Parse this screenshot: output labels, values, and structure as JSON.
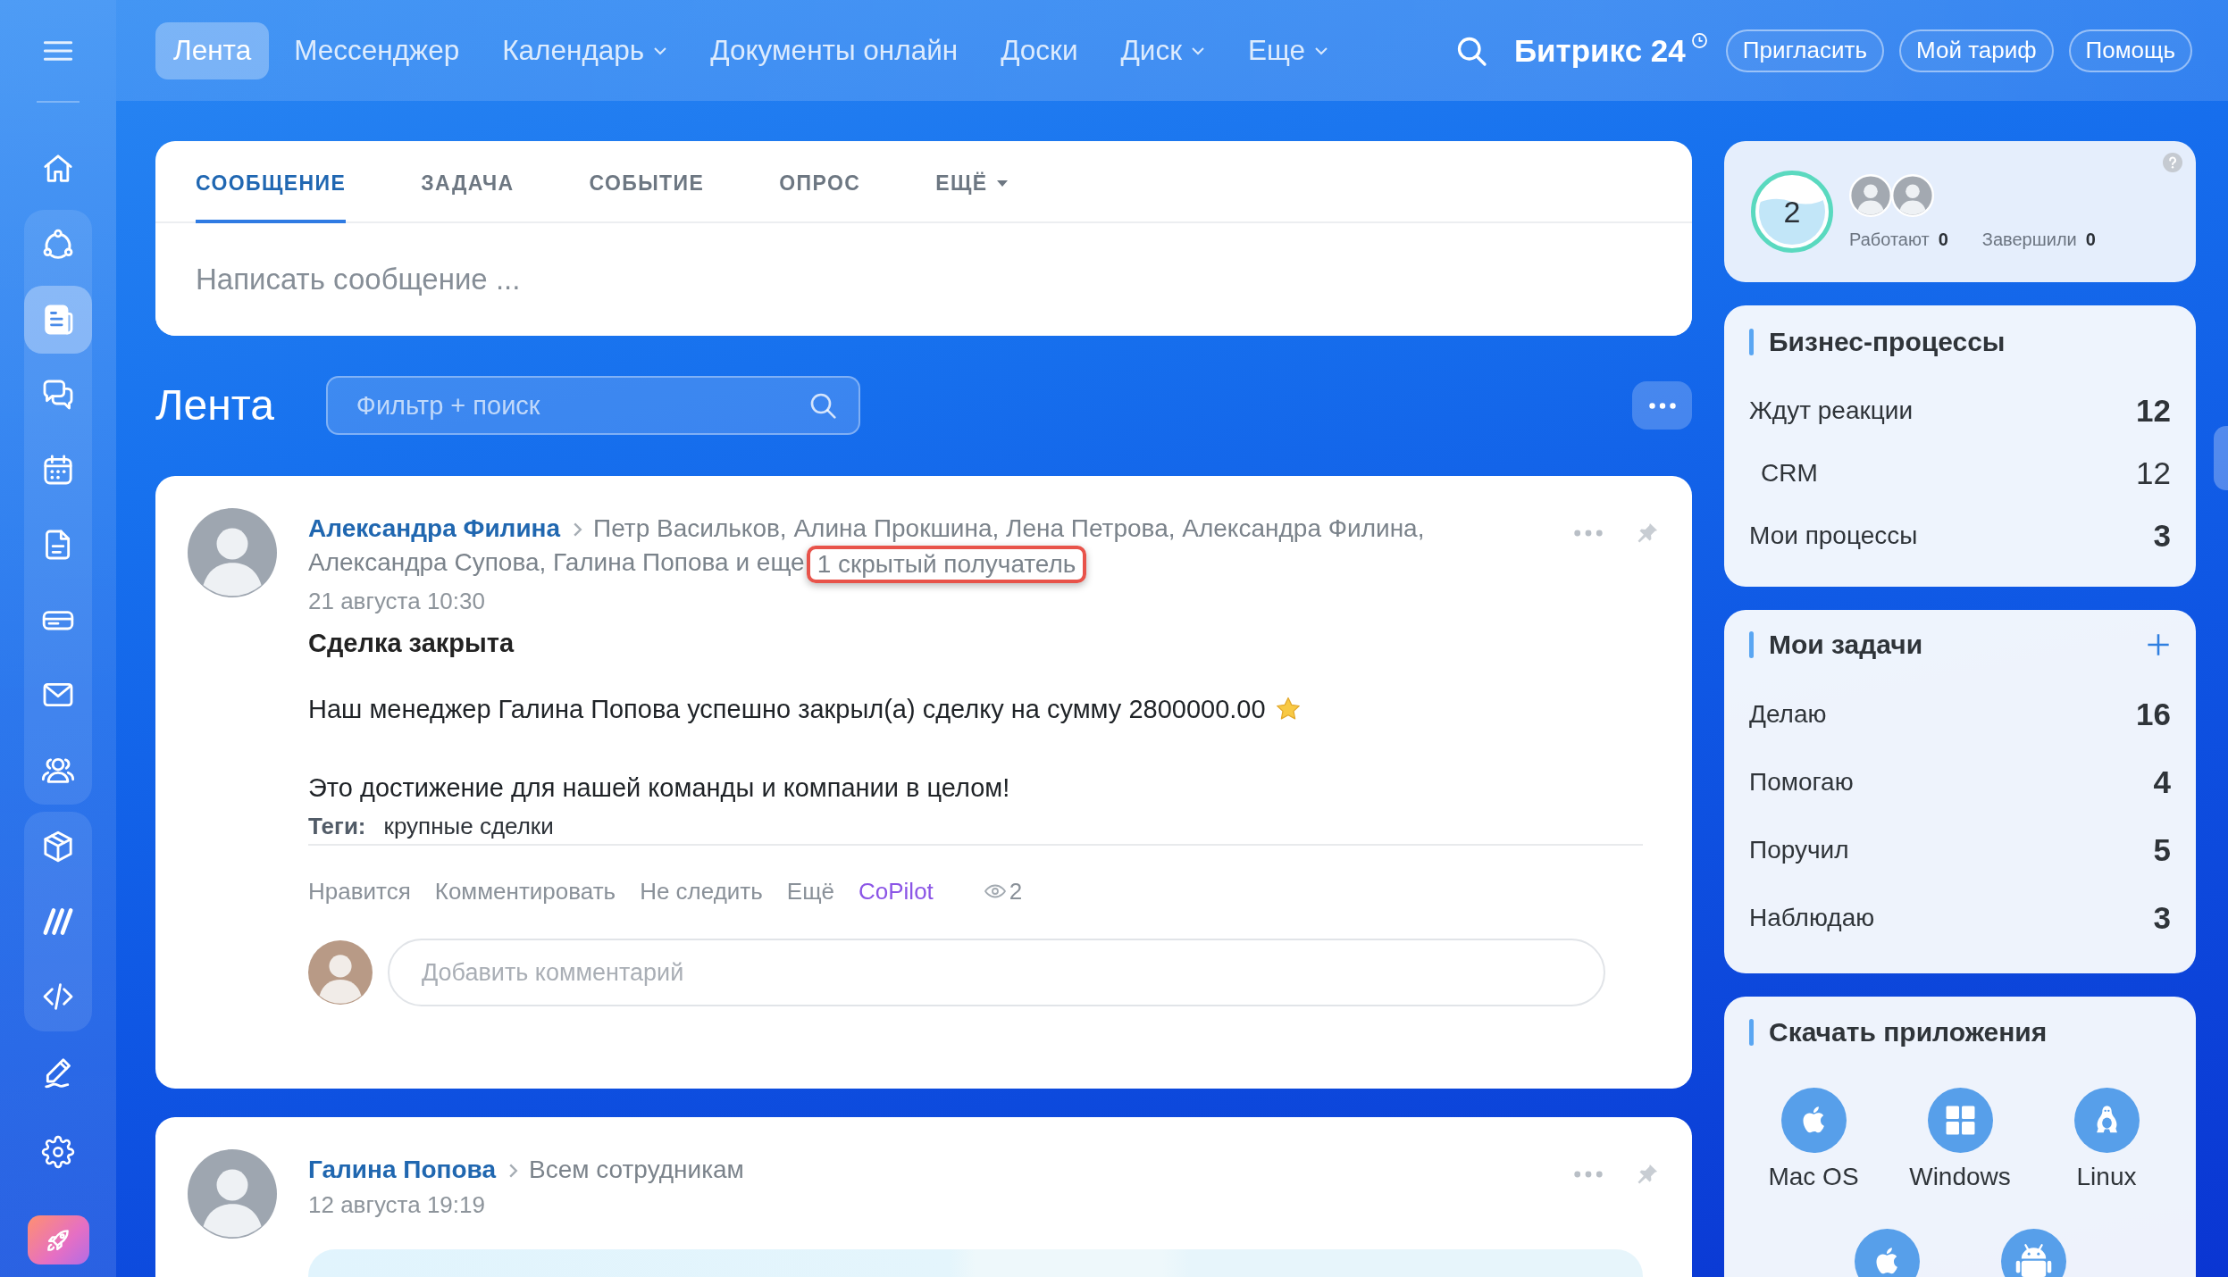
{
  "sidebar": {
    "sections": [
      {
        "boxed": false,
        "items": [
          {
            "kind": "home",
            "selected": false
          }
        ]
      },
      {
        "boxed": true,
        "items": [
          {
            "kind": "processes",
            "selected": false
          },
          {
            "kind": "feed",
            "selected": true
          },
          {
            "kind": "messenger",
            "selected": false
          },
          {
            "kind": "calendar",
            "selected": false
          },
          {
            "kind": "documents",
            "selected": false
          },
          {
            "kind": "drive",
            "selected": false
          },
          {
            "kind": "mail",
            "selected": false
          },
          {
            "kind": "team",
            "selected": false
          }
        ]
      },
      {
        "boxed": true,
        "items": [
          {
            "kind": "market",
            "selected": false
          },
          {
            "kind": "sign",
            "selected": false
          },
          {
            "kind": "developer",
            "selected": false
          }
        ]
      },
      {
        "boxed": false,
        "items": [
          {
            "kind": "edit",
            "selected": false
          },
          {
            "kind": "settings",
            "selected": false
          },
          {
            "kind": "launch",
            "selected": false
          }
        ]
      }
    ]
  },
  "nav": [
    {
      "label": "Лента",
      "selected": true,
      "dropdown": false
    },
    {
      "label": "Мессенджер",
      "selected": false,
      "dropdown": false
    },
    {
      "label": "Календарь",
      "selected": false,
      "dropdown": true
    },
    {
      "label": "Документы онлайн",
      "selected": false,
      "dropdown": false
    },
    {
      "label": "Доски",
      "selected": false,
      "dropdown": false
    },
    {
      "label": "Диск",
      "selected": false,
      "dropdown": true
    },
    {
      "label": "Еще",
      "selected": false,
      "dropdown": true
    }
  ],
  "header": {
    "brand": "Битрикс 24",
    "buttons": [
      "Пригласить",
      "Мой тариф",
      "Помощь"
    ]
  },
  "composer": {
    "tabs": [
      {
        "label": "СООБЩЕНИЕ",
        "selected": true,
        "dropdown": false
      },
      {
        "label": "ЗАДАЧА",
        "selected": false,
        "dropdown": false
      },
      {
        "label": "СОБЫТИЕ",
        "selected": false,
        "dropdown": false
      },
      {
        "label": "ОПРОС",
        "selected": false,
        "dropdown": false
      },
      {
        "label": "ЕЩЁ",
        "selected": false,
        "dropdown": true
      }
    ],
    "placeholder": "Написать сообщение ..."
  },
  "feed": {
    "title": "Лента",
    "filter": {
      "placeholder": "Фильтр + поиск"
    },
    "posts": [
      {
        "author": "Александра Филина",
        "recipients": "Петр Васильков, Алина Прокшина, Лена Петрова, Александра Филина, Александра Супова, Галина Попова и еще",
        "hidden_recipients": {
          "text": "1 скрытый получатель",
          "highlighted": true
        },
        "date": "21 августа 10:30",
        "title": "Сделка закрыта",
        "paragraphs": [
          {
            "text": "Наш менеджер Галина Попова успешно закрыл(а) сделку на сумму 2800000.00",
            "kind": "starred"
          },
          {
            "text": "Это достижение для нашей команды и компании в целом!",
            "kind": "plain"
          }
        ],
        "tags": {
          "label": "Теги:",
          "items": [
            "крупные сделки"
          ]
        },
        "actions": [
          {
            "label": "Нравится",
            "kind": "plain"
          },
          {
            "label": "Комментировать",
            "kind": "plain"
          },
          {
            "label": "Не следить",
            "kind": "plain"
          },
          {
            "label": "Ещё",
            "kind": "plain"
          },
          {
            "label": "CoPilot",
            "kind": "ai"
          }
        ],
        "views": "2",
        "comment_placeholder": "Добавить комментарий"
      },
      {
        "author": "Галина Попова",
        "recipients": "Всем сотрудникам",
        "date": "12 августа 19:19",
        "has_image": true
      }
    ]
  },
  "worktime": {
    "count": "2",
    "avatars": [
      {
        "kind": "photo"
      },
      {
        "kind": "photo"
      }
    ],
    "stats": [
      {
        "label": "Работают",
        "value": "0"
      },
      {
        "label": "Завершили",
        "value": "0"
      }
    ]
  },
  "business_processes": {
    "title": "Бизнес-процессы",
    "rows": [
      {
        "label": "Ждут реакции",
        "value": "12",
        "children": [
          {
            "label": "CRM",
            "value": "12"
          }
        ]
      },
      {
        "label": "Мои процессы",
        "value": "3"
      }
    ]
  },
  "tasks": {
    "title": "Мои задачи",
    "rows": [
      {
        "label": "Делаю",
        "value": "16"
      },
      {
        "label": "Помогаю",
        "value": "4"
      },
      {
        "label": "Поручил",
        "value": "5"
      },
      {
        "label": "Наблюдаю",
        "value": "3"
      }
    ]
  },
  "apps": {
    "title": "Скачать приложения",
    "items": [
      {
        "kind": "macos",
        "label": "Mac OS"
      },
      {
        "kind": "windows",
        "label": "Windows"
      },
      {
        "kind": "linux",
        "label": "Linux"
      },
      {
        "kind": "ios"
      },
      {
        "kind": "android"
      }
    ]
  }
}
